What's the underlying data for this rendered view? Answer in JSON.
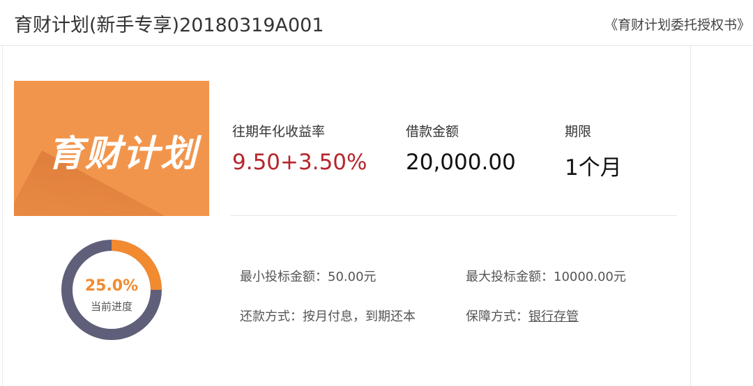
{
  "header": {
    "title": "育财计划(新手专享)20180319A001",
    "agreement_link": "《育财计划委托授权书》"
  },
  "banner": {
    "text": "育财计划"
  },
  "stats": {
    "rate_label": "往期年化收益率",
    "rate_value": "9.50+3.50%",
    "amount_label": "借款金额",
    "amount_value": "20,000.00",
    "term_label": "期限",
    "term_value": "1个月"
  },
  "progress": {
    "percent_text": "25.0%",
    "label": "当前进度",
    "fraction": 0.25,
    "fill_color": "#f28a30",
    "track_color": "#5f5f7a"
  },
  "details": {
    "min_label": "最小投标金额：",
    "min_value": "50.00元",
    "max_label": "最大投标金额：",
    "max_value": "10000.00元",
    "repay_label": "还款方式：",
    "repay_value": "按月付息，到期还本",
    "guarantee_label": "保障方式：",
    "guarantee_value": "银行存管"
  },
  "colors": {
    "accent_red": "#b5262c",
    "banner_orange": "#f2954c"
  }
}
